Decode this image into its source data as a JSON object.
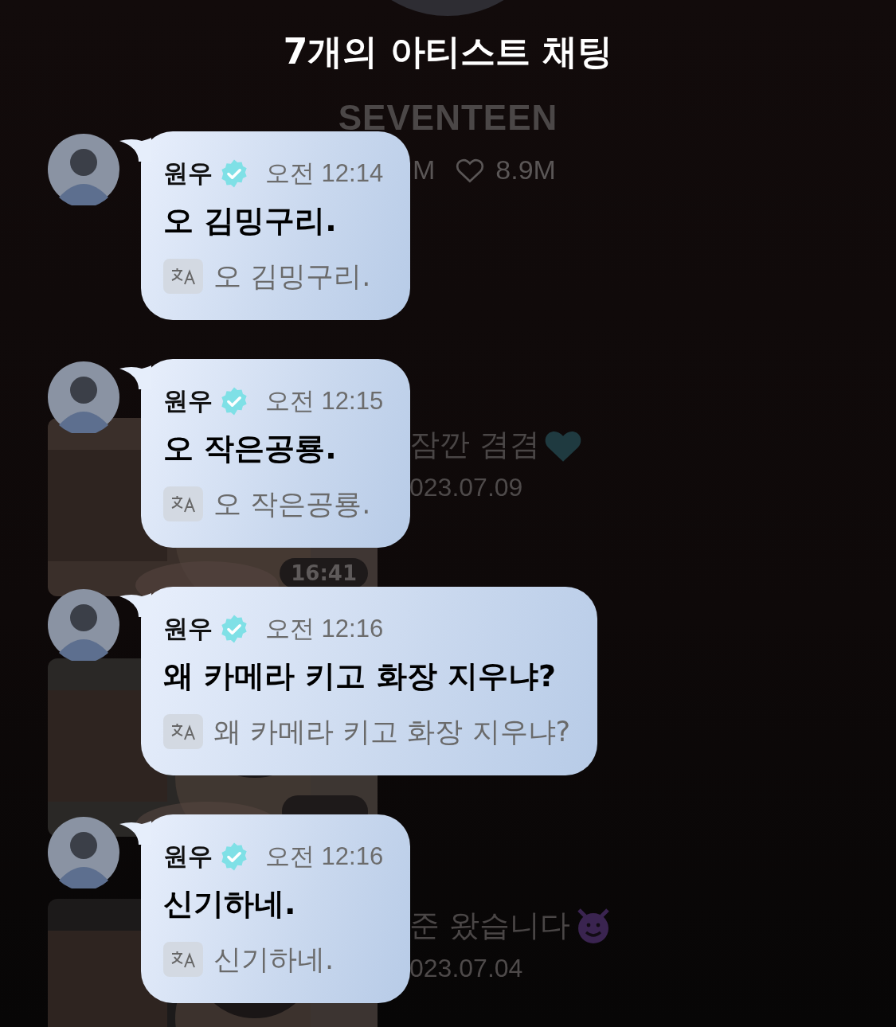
{
  "header": {
    "title": "7개의 아티스트 채팅"
  },
  "profile": {
    "name": "SEVENTEEN",
    "stats": [
      {
        "kind": "count",
        "value": "M"
      },
      {
        "kind": "likes",
        "value": "8.9M"
      }
    ]
  },
  "lives": [
    {
      "duration": "16:41",
      "title": "잠깐 겸겸",
      "kind": "heart",
      "date": "023.07.09"
    },
    {
      "kind": "badge"
    },
    {
      "title": "준 왔습니다",
      "kind": "devil",
      "date": "023.07.04"
    }
  ],
  "messages": [
    {
      "sender": "원우",
      "verified": true,
      "time": "오전 12:14",
      "text": "오 김밍구리.",
      "translation": "오 김밍구리."
    },
    {
      "sender": "원우",
      "verified": true,
      "time": "오전 12:15",
      "text": "오 작은공룡.",
      "translation": "오 작은공룡."
    },
    {
      "sender": "원우",
      "verified": true,
      "time": "오전 12:16",
      "text": "왜 카메라 키고 화장 지우냐?",
      "translation": "왜 카메라 키고 화장 지우냐?"
    },
    {
      "sender": "원우",
      "verified": true,
      "time": "오전 12:16",
      "text": "신기하네.",
      "translation": "신기하네."
    }
  ]
}
